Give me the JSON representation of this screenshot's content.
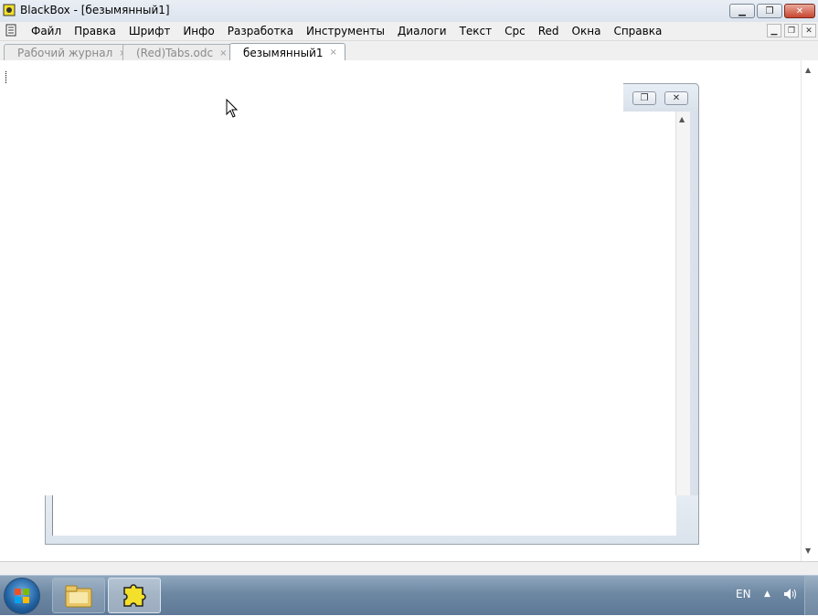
{
  "window": {
    "title": "BlackBox - [безымянный1]",
    "buttons": {
      "minimize": "▁",
      "maximize": "❐",
      "close": "✕"
    }
  },
  "menu": {
    "items": [
      "Файл",
      "Правка",
      "Шрифт",
      "Инфо",
      "Разработка",
      "Инструменты",
      "Диалоги",
      "Текст",
      "Срс",
      "Red",
      "Окна",
      "Справка"
    ],
    "mdi_buttons": {
      "minimize": "▁",
      "restore": "❐",
      "close": "✕"
    }
  },
  "tabs": [
    {
      "label": "Рабочий журнал",
      "close": "×",
      "active": false
    },
    {
      "label": "(Red)Tabs.odc",
      "close": "×",
      "active": false
    },
    {
      "label": "безымянный1",
      "close": "×",
      "active": true
    }
  ],
  "inner_window": {
    "buttons": {
      "restore": "❐",
      "close": "✕"
    }
  },
  "scroll": {
    "up": "▲",
    "down": "▼"
  },
  "taskbar": {
    "language": "EN",
    "tray_arrow": "▲",
    "volume_icon": "speaker-icon",
    "programs": [
      "explorer-icon",
      "blackbox-icon"
    ]
  },
  "colors": {
    "accent": "#1f5f9e",
    "close_red": "#c8462f",
    "taskbar": "#6d88a3"
  }
}
